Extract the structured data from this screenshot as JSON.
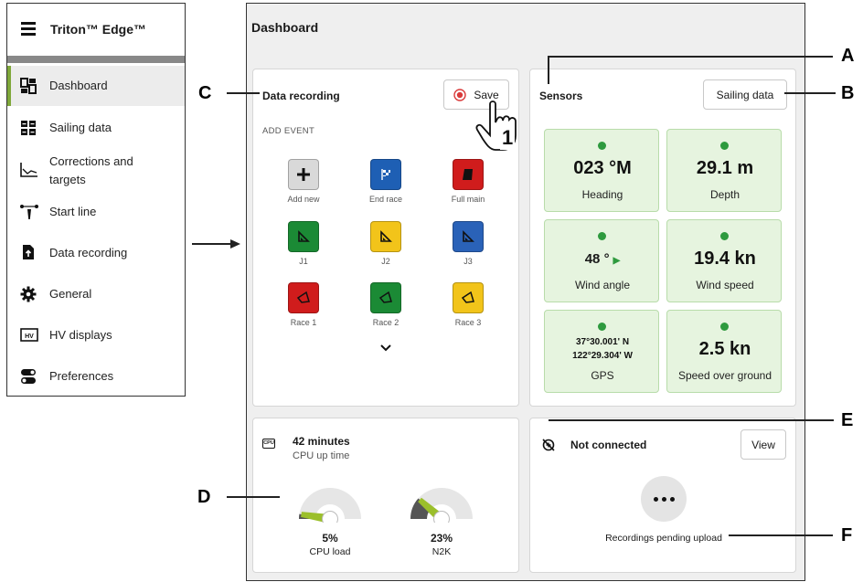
{
  "sidebar": {
    "title": "Triton™ Edge™",
    "items": [
      {
        "label": "Dashboard"
      },
      {
        "label": "Sailing data"
      },
      {
        "label": "Corrections and targets"
      },
      {
        "label": "Start line"
      },
      {
        "label": "Data recording"
      },
      {
        "label": "General"
      },
      {
        "label": "HV displays"
      },
      {
        "label": "Preferences"
      }
    ]
  },
  "page": {
    "title": "Dashboard"
  },
  "recording": {
    "title": "Data recording",
    "save_label": "Save",
    "add_event_label": "ADD EVENT",
    "events": [
      {
        "label": "Add new",
        "color": "#d9d9d9"
      },
      {
        "label": "End race",
        "color": "#1e5fb4"
      },
      {
        "label": "Full main",
        "color": "#d01c1c"
      },
      {
        "label": "J1",
        "color": "#1b8a35"
      },
      {
        "label": "J2",
        "color": "#f2c41a"
      },
      {
        "label": "J3",
        "color": "#2a62b8"
      },
      {
        "label": "Race 1",
        "color": "#d01c1c"
      },
      {
        "label": "Race 2",
        "color": "#1b8a35"
      },
      {
        "label": "Race 3",
        "color": "#f2c41a"
      }
    ]
  },
  "sensors": {
    "title": "Sensors",
    "button_label": "Sailing data",
    "tiles": [
      {
        "value": "023 °M",
        "label": "Heading"
      },
      {
        "value": "29.1 m",
        "label": "Depth"
      },
      {
        "value": "48 °",
        "label": "Wind angle"
      },
      {
        "value": "19.4 kn",
        "label": "Wind speed"
      },
      {
        "value_line1": "37°30.001' N",
        "value_line2": "122°29.304' W",
        "label": "GPS"
      },
      {
        "value": "2.5 kn",
        "label": "Speed over ground"
      }
    ]
  },
  "cpu": {
    "icon_text": "CPU",
    "uptime_value": "42 minutes",
    "uptime_label": "CPU up time",
    "gauges": [
      {
        "value": "5%",
        "label": "CPU load",
        "fraction": 0.05
      },
      {
        "value": "23%",
        "label": "N2K",
        "fraction": 0.23
      }
    ]
  },
  "upload": {
    "status": "Not connected",
    "view_label": "View",
    "pending_label": "Recordings pending upload"
  },
  "annotations": {
    "A": "A",
    "B": "B",
    "C": "C",
    "D": "D",
    "E": "E",
    "F": "F",
    "step": "1"
  },
  "colors": {
    "accent": "#7fa83a",
    "sensor_bg": "#e6f4df",
    "status_dot": "#2e9a3e",
    "record_red": "#d93a3a"
  }
}
